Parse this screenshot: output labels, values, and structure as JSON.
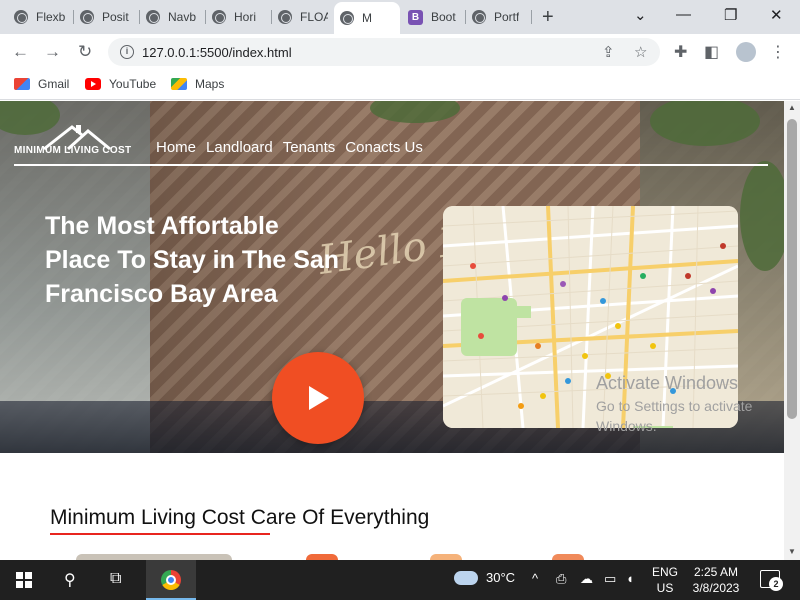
{
  "browser": {
    "tabs": [
      {
        "label": "Flexb",
        "icon": "globe-icon",
        "active": false
      },
      {
        "label": "Posit",
        "icon": "globe-icon",
        "active": false
      },
      {
        "label": "Navb",
        "icon": "globe-icon",
        "active": false
      },
      {
        "label": "Hori",
        "icon": "globe-icon",
        "active": false
      },
      {
        "label": "FLOA",
        "icon": "globe-icon",
        "active": false
      },
      {
        "label": "M",
        "icon": "globe-icon",
        "active": true
      },
      {
        "label": "Boot",
        "icon": "bootstrap-icon",
        "active": false
      },
      {
        "label": "Portf",
        "icon": "globe-icon",
        "active": false
      }
    ],
    "new_tab_symbol": "+",
    "window_controls": {
      "chevron": "⌄",
      "minimize": "—",
      "restore": "❐",
      "close": "✕"
    },
    "url": "127.0.0.1:5500/index.html",
    "bookmarks": [
      {
        "label": "Gmail",
        "icon": "gmail-icon"
      },
      {
        "label": "YouTube",
        "icon": "youtube-icon"
      },
      {
        "label": "Maps",
        "icon": "maps-icon"
      }
    ],
    "bootstrap_letter": "B"
  },
  "site": {
    "logo_text": "MINIMUM LIVING COST",
    "nav": [
      "Home",
      "Landloard",
      "Tenants",
      "Conacts Us"
    ],
    "headline": "The Most Affortable Place To Stay in The San Francisco Bay Area",
    "decor_sign": "Hello Hust",
    "section_title_highlight": "Minimum Living Cost",
    "section_title_rest": " Care Of Everything",
    "accent_color": "#f04e23",
    "underline_color": "#e8251f"
  },
  "watermark": {
    "title": "Activate Windows",
    "subtitle": "Go to Settings to activate Windows."
  },
  "taskbar": {
    "temperature": "30°C",
    "language_line1": "ENG",
    "language_line2": "US",
    "time": "2:25 AM",
    "date": "3/8/2023",
    "notification_count": "2"
  }
}
